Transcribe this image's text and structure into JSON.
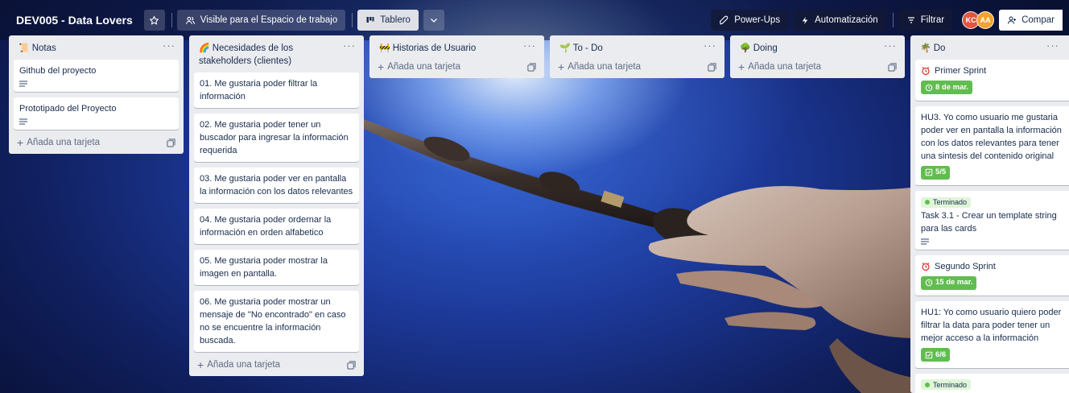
{
  "board": {
    "title": "DEV005 - Data Lovers",
    "visibility_label": "Visible para el Espacio de trabajo",
    "view_label": "Tablero",
    "powerups_label": "Power-Ups",
    "automation_label": "Automatización",
    "filter_label": "Filtrar",
    "share_label": "Compar",
    "members": [
      {
        "initials": "KC",
        "color": "#e2553f"
      },
      {
        "initials": "AA",
        "color": "#f2a32d"
      }
    ]
  },
  "add_card_label": "Añada una tarjeta",
  "lists": [
    {
      "emoji": "📜",
      "title": "Notas",
      "cards": [
        {
          "text": "Github del proyecto",
          "has_description": true
        },
        {
          "text": "Prototipado del Proyecto",
          "has_description": true
        }
      ]
    },
    {
      "emoji": "🌈",
      "title": "Necesidades de los stakeholders (clientes)",
      "cards": [
        {
          "text": "01. Me gustaria poder filtrar la información"
        },
        {
          "text": "02. Me gustaria poder tener un buscador para ingresar la información requerida"
        },
        {
          "text": "03. Me gustaria poder ver en pantalla la información con los datos relevantes"
        },
        {
          "text": "04. Me gustaria poder ordernar la información en orden alfabetico"
        },
        {
          "text": "05. Me gustaria poder mostrar la imagen en pantalla."
        },
        {
          "text": "06. Me gustaria poder mostrar un mensaje de \"No encontrado\" en caso no se encuentre la información buscada."
        }
      ]
    },
    {
      "emoji": "🚧",
      "title": "Historias de Usuario",
      "cards": []
    },
    {
      "emoji": "🌱",
      "title": "To - Do",
      "cards": []
    },
    {
      "emoji": "🌳",
      "title": "Doing",
      "cards": []
    },
    {
      "emoji": "🌴",
      "title": "Do",
      "cards": [
        {
          "text": "Primer Sprint",
          "clock": true,
          "date": "8 de mar."
        },
        {
          "text": "HU3. Yo como usuario me gustaria poder ver en pantalla la información con los datos relevantes para tener una sintesis del contenido original",
          "checklist": "5/5"
        },
        {
          "label": "Terminado",
          "text": "Task 3.1 - Crear un template string para las cards",
          "has_description": true
        },
        {
          "text": "Segundo Sprint",
          "clock": true,
          "date": "15 de mar."
        },
        {
          "text": "HU1: Yo como usuario quiero poder filtrar la data para poder tener un mejor acceso a la información",
          "checklist": "6/6"
        },
        {
          "label": "Terminado",
          "text": ""
        }
      ]
    }
  ],
  "colors": {
    "list_bg": "#ebecf0",
    "done_green": "#61bd4f",
    "text": "#172b4d"
  }
}
